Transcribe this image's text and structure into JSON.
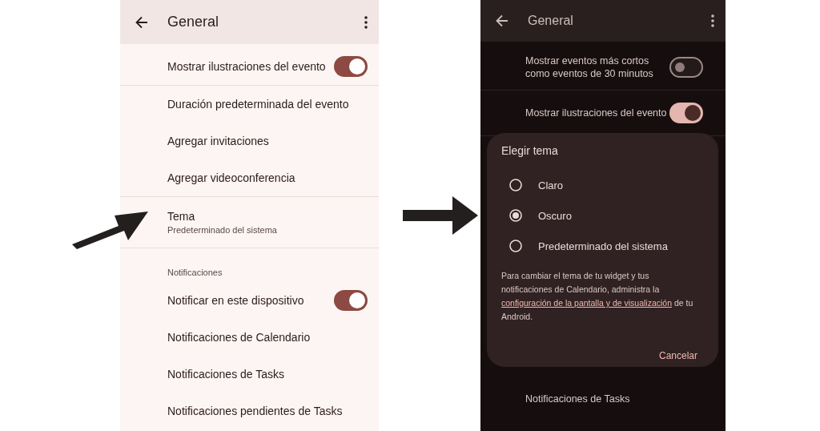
{
  "screens": [
    {
      "kind": "light",
      "header": {
        "title": "General"
      },
      "items": [
        {
          "kind": "toggle",
          "label": "Mostrar ilustraciones del evento",
          "on": true
        },
        {
          "kind": "divider"
        },
        {
          "kind": "plain",
          "label": "Duración predeterminada del evento"
        },
        {
          "kind": "plain",
          "label": "Agregar invitaciones"
        },
        {
          "kind": "plain",
          "label": "Agregar videoconferencia"
        },
        {
          "kind": "divider"
        },
        {
          "kind": "two_line",
          "label": "Tema",
          "subtitle": "Predeterminado del sistema"
        },
        {
          "kind": "divider"
        },
        {
          "kind": "section",
          "label": "Notificaciones"
        },
        {
          "kind": "toggle",
          "label": "Notificar en este dispositivo",
          "on": true
        },
        {
          "kind": "plain",
          "label": "Notificaciones de Calendario"
        },
        {
          "kind": "plain",
          "label": "Notificaciones de Tasks"
        },
        {
          "kind": "plain",
          "label": "Notificaciones pendientes de Tasks"
        }
      ]
    },
    {
      "kind": "dark",
      "header": {
        "title": "General"
      },
      "items": [
        {
          "kind": "toggle",
          "label": "Mostrar eventos más cortos como eventos de 30 minutos",
          "on": false
        },
        {
          "kind": "divider"
        },
        {
          "kind": "toggle",
          "label": "Mostrar ilustraciones del evento",
          "on": true
        },
        {
          "kind": "divider"
        },
        {
          "kind": "spacer"
        },
        {
          "kind": "plain",
          "label": "Notificaciones de Tasks"
        }
      ],
      "dialog": {
        "title": "Elegir tema",
        "options": [
          {
            "label": "Claro",
            "selected": false
          },
          {
            "label": "Oscuro",
            "selected": true
          },
          {
            "label": "Predeterminado del sistema",
            "selected": false
          }
        ],
        "text_before": "Para cambiar el tema de tu widget y tus notificaciones de Calendario, administra la",
        "link": "configuración de la pantalla y de visualización",
        "text_after": "de tu Android.",
        "button": "Cancelar"
      }
    }
  ]
}
